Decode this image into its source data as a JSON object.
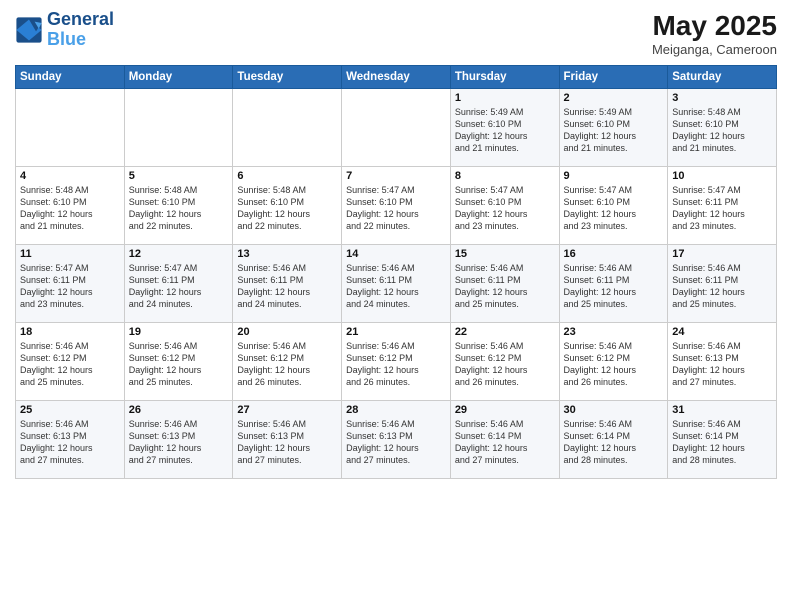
{
  "logo": {
    "line1": "General",
    "line2": "Blue"
  },
  "title": "May 2025",
  "location": "Meiganga, Cameroon",
  "weekdays": [
    "Sunday",
    "Monday",
    "Tuesday",
    "Wednesday",
    "Thursday",
    "Friday",
    "Saturday"
  ],
  "weeks": [
    [
      {
        "day": "",
        "detail": ""
      },
      {
        "day": "",
        "detail": ""
      },
      {
        "day": "",
        "detail": ""
      },
      {
        "day": "",
        "detail": ""
      },
      {
        "day": "1",
        "detail": "Sunrise: 5:49 AM\nSunset: 6:10 PM\nDaylight: 12 hours\nand 21 minutes."
      },
      {
        "day": "2",
        "detail": "Sunrise: 5:49 AM\nSunset: 6:10 PM\nDaylight: 12 hours\nand 21 minutes."
      },
      {
        "day": "3",
        "detail": "Sunrise: 5:48 AM\nSunset: 6:10 PM\nDaylight: 12 hours\nand 21 minutes."
      }
    ],
    [
      {
        "day": "4",
        "detail": "Sunrise: 5:48 AM\nSunset: 6:10 PM\nDaylight: 12 hours\nand 21 minutes."
      },
      {
        "day": "5",
        "detail": "Sunrise: 5:48 AM\nSunset: 6:10 PM\nDaylight: 12 hours\nand 22 minutes."
      },
      {
        "day": "6",
        "detail": "Sunrise: 5:48 AM\nSunset: 6:10 PM\nDaylight: 12 hours\nand 22 minutes."
      },
      {
        "day": "7",
        "detail": "Sunrise: 5:47 AM\nSunset: 6:10 PM\nDaylight: 12 hours\nand 22 minutes."
      },
      {
        "day": "8",
        "detail": "Sunrise: 5:47 AM\nSunset: 6:10 PM\nDaylight: 12 hours\nand 23 minutes."
      },
      {
        "day": "9",
        "detail": "Sunrise: 5:47 AM\nSunset: 6:10 PM\nDaylight: 12 hours\nand 23 minutes."
      },
      {
        "day": "10",
        "detail": "Sunrise: 5:47 AM\nSunset: 6:11 PM\nDaylight: 12 hours\nand 23 minutes."
      }
    ],
    [
      {
        "day": "11",
        "detail": "Sunrise: 5:47 AM\nSunset: 6:11 PM\nDaylight: 12 hours\nand 23 minutes."
      },
      {
        "day": "12",
        "detail": "Sunrise: 5:47 AM\nSunset: 6:11 PM\nDaylight: 12 hours\nand 24 minutes."
      },
      {
        "day": "13",
        "detail": "Sunrise: 5:46 AM\nSunset: 6:11 PM\nDaylight: 12 hours\nand 24 minutes."
      },
      {
        "day": "14",
        "detail": "Sunrise: 5:46 AM\nSunset: 6:11 PM\nDaylight: 12 hours\nand 24 minutes."
      },
      {
        "day": "15",
        "detail": "Sunrise: 5:46 AM\nSunset: 6:11 PM\nDaylight: 12 hours\nand 25 minutes."
      },
      {
        "day": "16",
        "detail": "Sunrise: 5:46 AM\nSunset: 6:11 PM\nDaylight: 12 hours\nand 25 minutes."
      },
      {
        "day": "17",
        "detail": "Sunrise: 5:46 AM\nSunset: 6:11 PM\nDaylight: 12 hours\nand 25 minutes."
      }
    ],
    [
      {
        "day": "18",
        "detail": "Sunrise: 5:46 AM\nSunset: 6:12 PM\nDaylight: 12 hours\nand 25 minutes."
      },
      {
        "day": "19",
        "detail": "Sunrise: 5:46 AM\nSunset: 6:12 PM\nDaylight: 12 hours\nand 25 minutes."
      },
      {
        "day": "20",
        "detail": "Sunrise: 5:46 AM\nSunset: 6:12 PM\nDaylight: 12 hours\nand 26 minutes."
      },
      {
        "day": "21",
        "detail": "Sunrise: 5:46 AM\nSunset: 6:12 PM\nDaylight: 12 hours\nand 26 minutes."
      },
      {
        "day": "22",
        "detail": "Sunrise: 5:46 AM\nSunset: 6:12 PM\nDaylight: 12 hours\nand 26 minutes."
      },
      {
        "day": "23",
        "detail": "Sunrise: 5:46 AM\nSunset: 6:12 PM\nDaylight: 12 hours\nand 26 minutes."
      },
      {
        "day": "24",
        "detail": "Sunrise: 5:46 AM\nSunset: 6:13 PM\nDaylight: 12 hours\nand 27 minutes."
      }
    ],
    [
      {
        "day": "25",
        "detail": "Sunrise: 5:46 AM\nSunset: 6:13 PM\nDaylight: 12 hours\nand 27 minutes."
      },
      {
        "day": "26",
        "detail": "Sunrise: 5:46 AM\nSunset: 6:13 PM\nDaylight: 12 hours\nand 27 minutes."
      },
      {
        "day": "27",
        "detail": "Sunrise: 5:46 AM\nSunset: 6:13 PM\nDaylight: 12 hours\nand 27 minutes."
      },
      {
        "day": "28",
        "detail": "Sunrise: 5:46 AM\nSunset: 6:13 PM\nDaylight: 12 hours\nand 27 minutes."
      },
      {
        "day": "29",
        "detail": "Sunrise: 5:46 AM\nSunset: 6:14 PM\nDaylight: 12 hours\nand 27 minutes."
      },
      {
        "day": "30",
        "detail": "Sunrise: 5:46 AM\nSunset: 6:14 PM\nDaylight: 12 hours\nand 28 minutes."
      },
      {
        "day": "31",
        "detail": "Sunrise: 5:46 AM\nSunset: 6:14 PM\nDaylight: 12 hours\nand 28 minutes."
      }
    ]
  ]
}
